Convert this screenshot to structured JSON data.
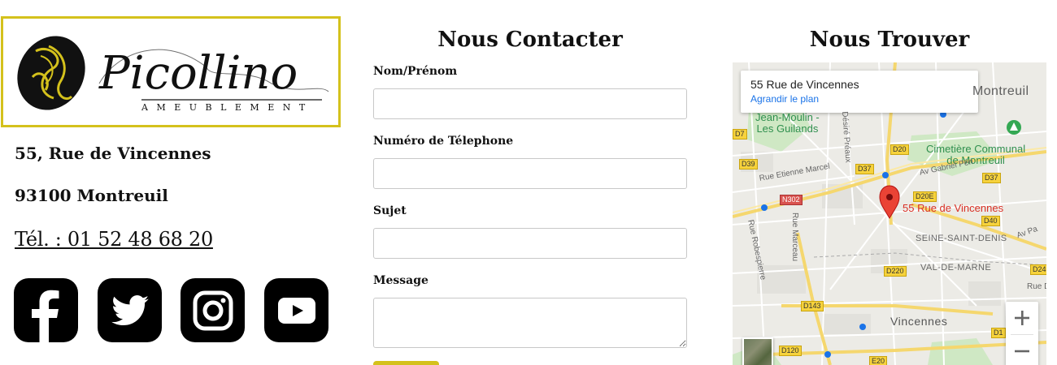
{
  "logo": {
    "brand": "Picollino",
    "tagline": "AMEUBLEMENT",
    "border_color": "#d4c11c",
    "accent_color": "#d4c11c"
  },
  "address": {
    "street": "55, Rue de Vincennes",
    "city": "93100 Montreuil",
    "phone": "Tél. : 01 52 48 68 20"
  },
  "social": [
    {
      "icon": "facebook-icon"
    },
    {
      "icon": "twitter-icon"
    },
    {
      "icon": "instagram-icon"
    },
    {
      "icon": "youtube-icon"
    }
  ],
  "contact": {
    "title": "Nous Contacter",
    "fields": {
      "name_label": "Nom/Prénom",
      "phone_label": "Numéro de Télephone",
      "subject_label": "Sujet",
      "message_label": "Message"
    },
    "submit_color": "#d4c11c"
  },
  "find": {
    "title": "Nous Trouver"
  },
  "map": {
    "card_title": "55 Rue de Vincennes",
    "card_link": "Agrandir le plan",
    "labels": {
      "montreuil": "Montreuil",
      "jean_moulin": "Jean-Moulin -",
      "guilands": "Les Guilands",
      "cimetiere1": "Cimetière Communal",
      "cimetiere2": "de Montreuil",
      "marker": "55 Rue de Vincennes",
      "seine_saint_denis": "SEINE-SAINT-DENIS",
      "val_de_marne": "VAL-DE-MARNE",
      "vincennes": "Vincennes",
      "rue_etienne_marcel": "Rue Etienne Marcel",
      "av_gabriel_peri": "Av Gabriel Péri",
      "av_pa": "Av Pa",
      "rue_dide": "Rue Dide",
      "rue_robespierre": "Rue Robespierre",
      "rue_marceau": "Rue Marceau",
      "desire_preaux": "Désiré Préaux"
    },
    "shields": {
      "d39": "D39",
      "d20": "D20",
      "d37a": "D37",
      "d37b": "D37",
      "n302": "N302",
      "d20e": "D20E",
      "d40": "D40",
      "d220": "D220",
      "d24": "D24",
      "d143": "D143",
      "d120": "D120",
      "d1": "D1",
      "e20": "E20",
      "d7": "D7"
    },
    "marker_color": "#d93025"
  }
}
